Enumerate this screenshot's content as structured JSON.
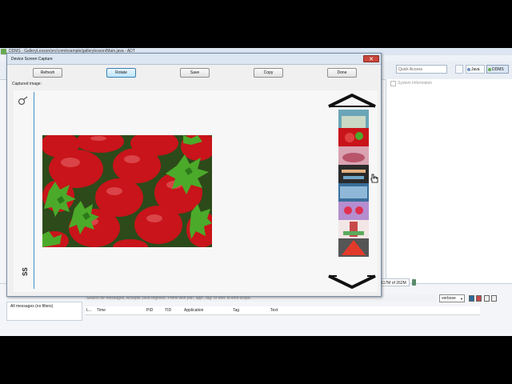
{
  "ide": {
    "title": "DDMS - GalleryLesson/src/com/example/gallerylesson/Main.java - ADT",
    "quick_access_placeholder": "Quick Access",
    "perspectives": {
      "java": "Java",
      "ddms": "DDMS"
    },
    "system_information": "System Information",
    "logcat": {
      "search_placeholder": "Search for messages. Accepts Java regexes. Prefix with pid:, app:, tag: or text: to limit scope.",
      "filter_item": "All messages (no filters)",
      "level": "verbose",
      "columns": [
        "L...",
        "Time",
        "PID",
        "TID",
        "Application",
        "Tag",
        "Text"
      ]
    },
    "memory": "117M of 262M"
  },
  "dialog": {
    "title": "Device Screen Capture",
    "buttons": {
      "refresh": "Refresh",
      "rotate": "Rotate",
      "save": "Save",
      "copy": "Copy",
      "done": "Done"
    },
    "captured_label": "Captured image:",
    "side_text": "SS"
  },
  "colors": {
    "title_bar": "#dbe6f2",
    "close_button": "#c8463a",
    "strip_border": "#4a90c8",
    "strawberry_red": "#c8141a"
  },
  "icons": [
    "gear-icon",
    "seek-bar-icon",
    "scroll-up-arrow-icon",
    "scroll-down-arrow-icon",
    "hand-cursor-icon",
    "close-icon"
  ]
}
